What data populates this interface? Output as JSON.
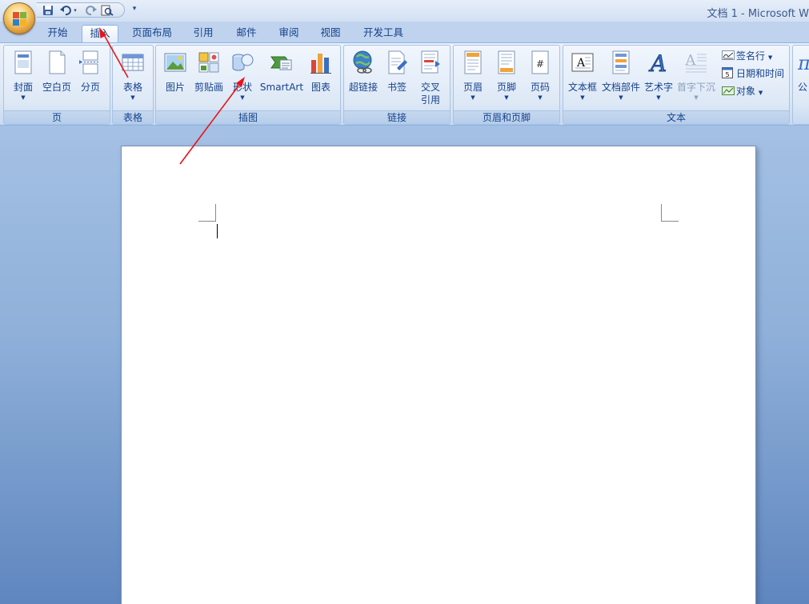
{
  "window": {
    "title": "文档 1 - Microsoft W"
  },
  "quick_access": {
    "items": [
      "save-icon",
      "undo-icon",
      "undo-dropdown",
      "redo-icon",
      "print-preview-icon",
      "customize-dropdown"
    ]
  },
  "tabs": [
    {
      "label": "开始"
    },
    {
      "label": "插入",
      "active": true
    },
    {
      "label": "页面布局"
    },
    {
      "label": "引用"
    },
    {
      "label": "邮件"
    },
    {
      "label": "审阅"
    },
    {
      "label": "视图"
    },
    {
      "label": "开发工具"
    }
  ],
  "ribbon": {
    "groups": {
      "pages": {
        "title": "页",
        "items": [
          {
            "label": "封面",
            "dropdown": true
          },
          {
            "label": "空白页"
          },
          {
            "label": "分页"
          }
        ]
      },
      "tables": {
        "title": "表格",
        "items": [
          {
            "label": "表格",
            "dropdown": true
          }
        ]
      },
      "illustrations": {
        "title": "插图",
        "items": [
          {
            "label": "图片"
          },
          {
            "label": "剪贴画"
          },
          {
            "label": "形状",
            "dropdown": true
          },
          {
            "label": "SmartArt"
          },
          {
            "label": "图表"
          }
        ]
      },
      "links": {
        "title": "链接",
        "items": [
          {
            "label": "超链接"
          },
          {
            "label": "书签"
          },
          {
            "label": "交叉"
          },
          {
            "label": "引用"
          }
        ]
      },
      "header_footer": {
        "title": "页眉和页脚",
        "items": [
          {
            "label": "页眉",
            "dropdown": true
          },
          {
            "label": "页脚",
            "dropdown": true
          },
          {
            "label": "页码",
            "dropdown": true
          }
        ]
      },
      "text": {
        "title": "文本",
        "items": [
          {
            "label": "文本框",
            "dropdown": true
          },
          {
            "label": "文档部件",
            "dropdown": true
          },
          {
            "label": "艺术字",
            "dropdown": true
          },
          {
            "label": "首字下沉",
            "dropdown": true,
            "disabled": true
          }
        ],
        "small_items": [
          {
            "label": "签名行",
            "dropdown": true
          },
          {
            "label": "日期和时间"
          },
          {
            "label": "对象",
            "dropdown": true
          }
        ]
      },
      "symbols": {
        "partial_label": "公"
      }
    }
  },
  "colors": {
    "accent": "#15428b",
    "annotation": "#e8141a"
  }
}
